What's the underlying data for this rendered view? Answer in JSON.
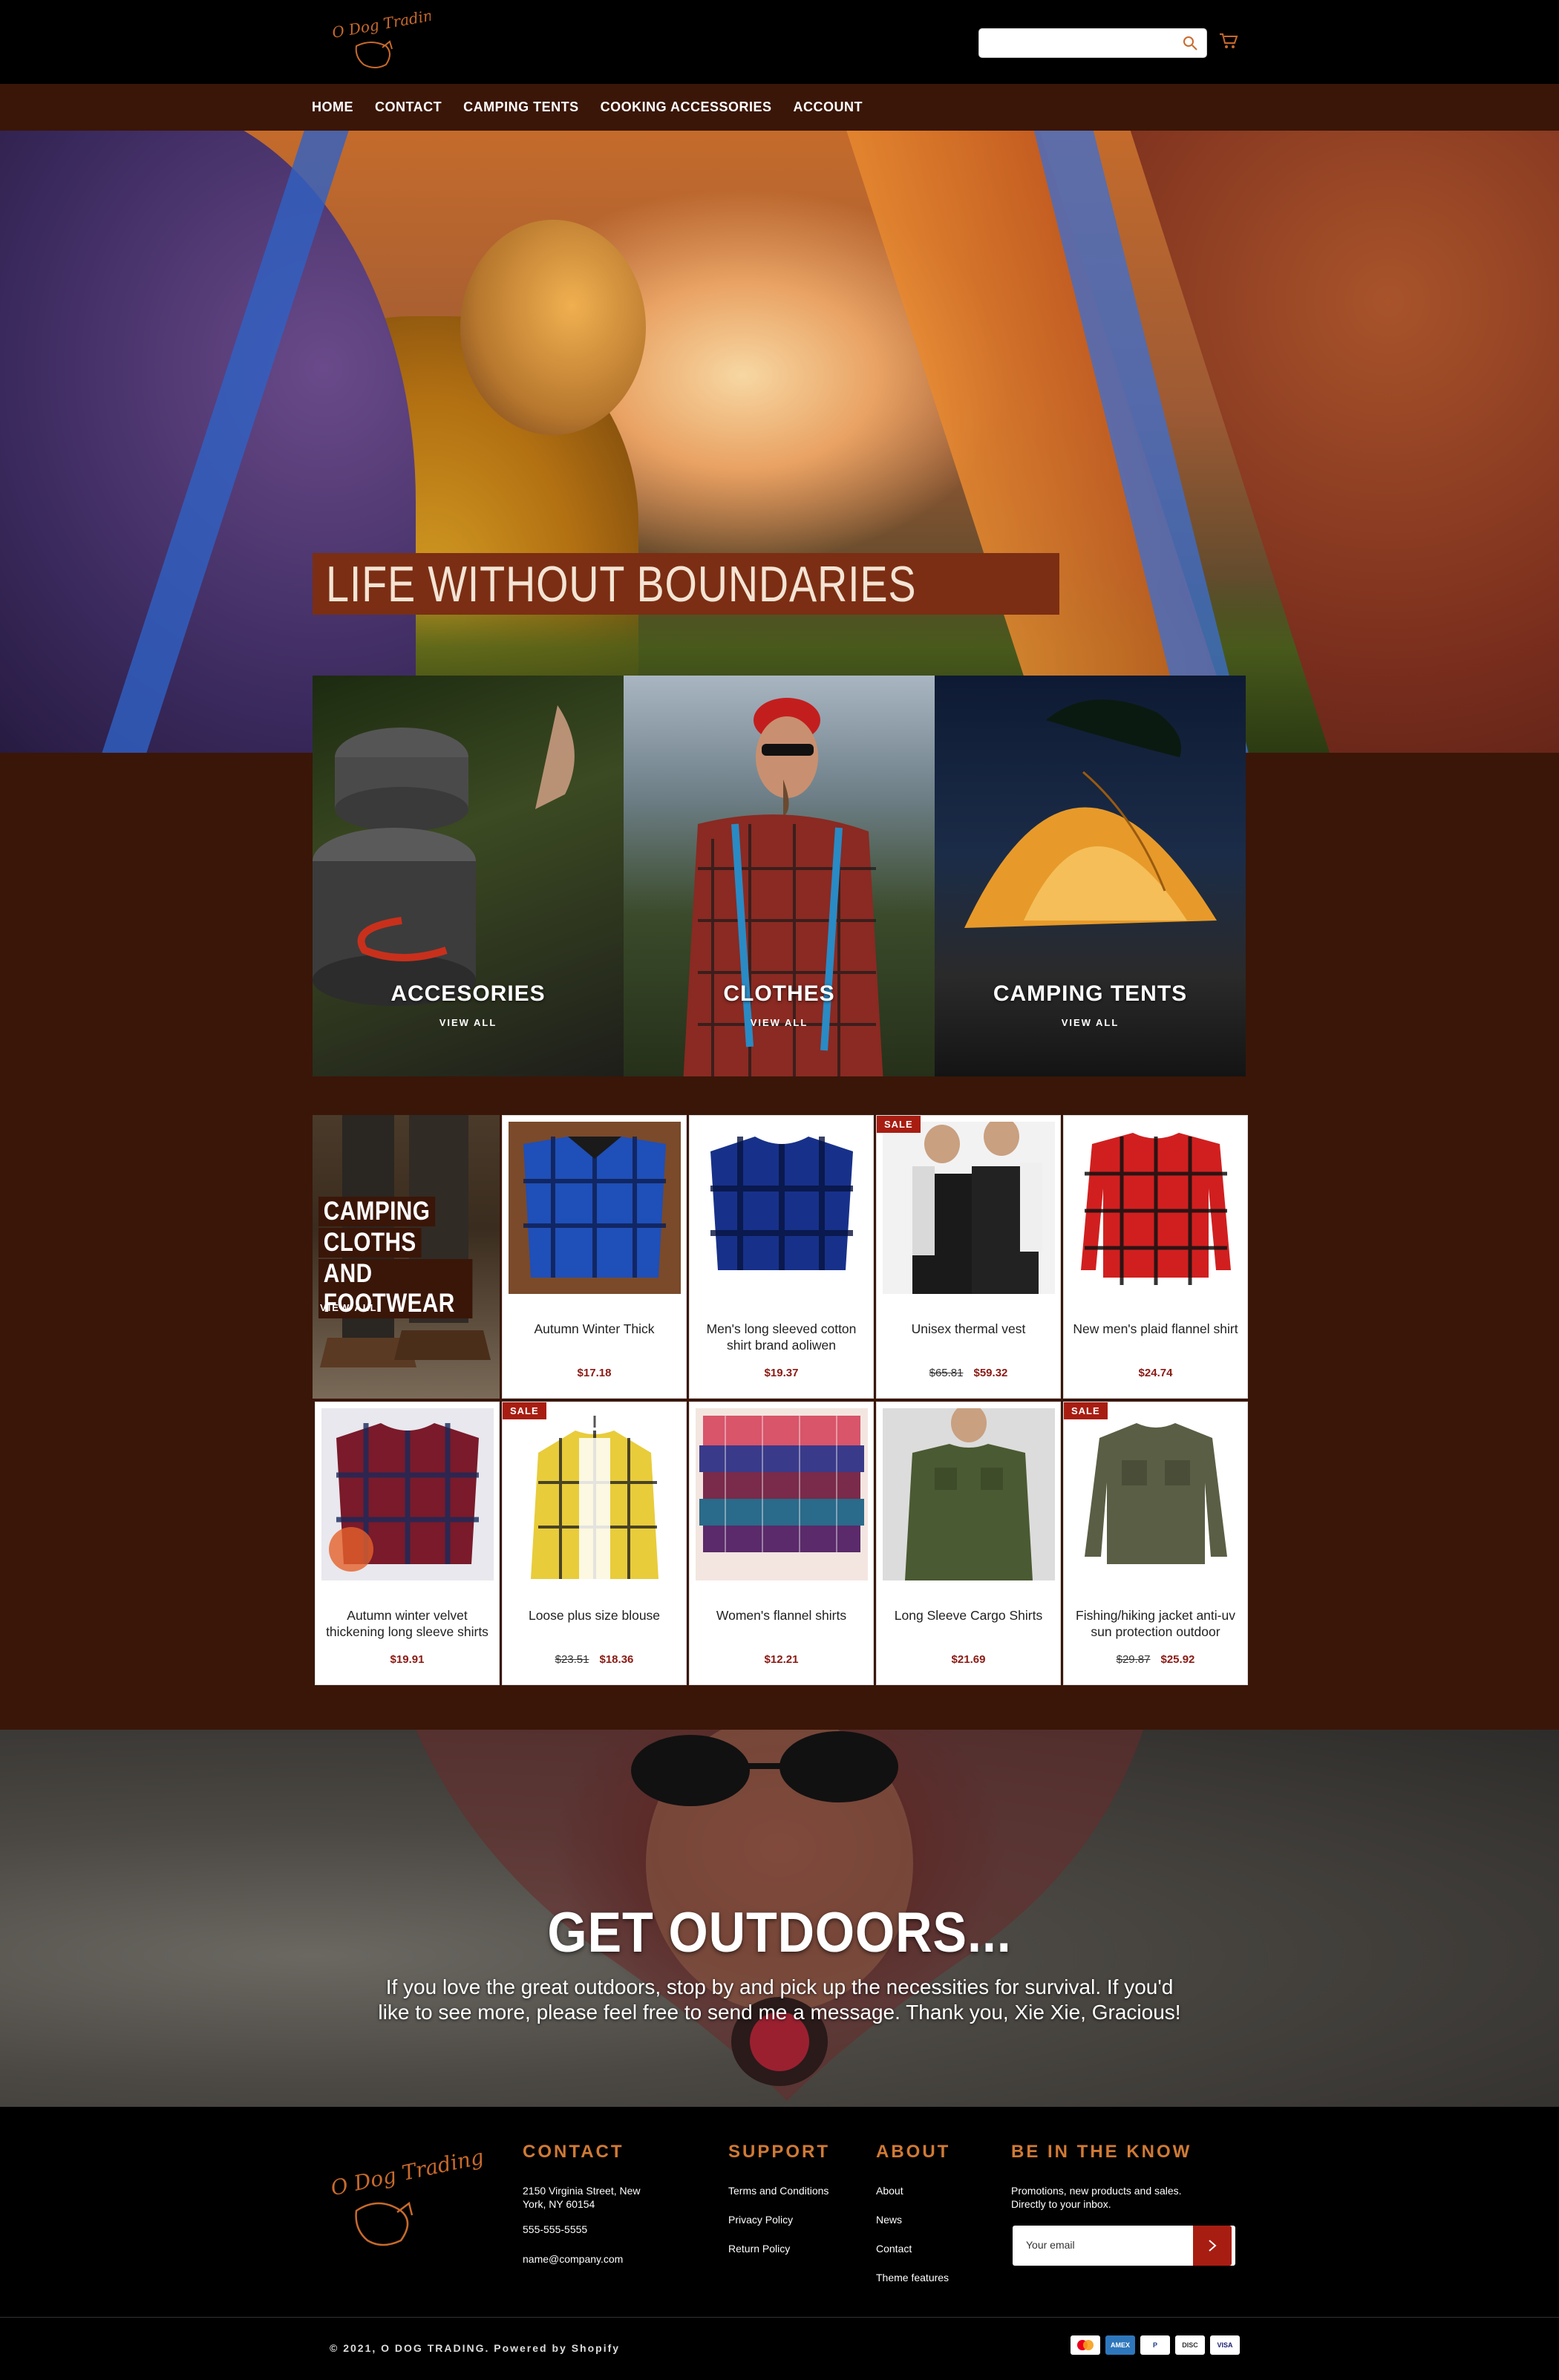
{
  "header": {
    "logo_text": "O Dog Trading",
    "search": {
      "placeholder": ""
    },
    "nav": [
      "HOME",
      "CONTACT",
      "CAMPING TENTS",
      "COOKING ACCESSORIES",
      "ACCOUNT"
    ]
  },
  "hero": {
    "title": "LIFE WITHOUT BOUNDARIES"
  },
  "categories": [
    {
      "label": "ACCESORIES",
      "link": "VIEW ALL"
    },
    {
      "label": "CLOTHES",
      "link": "VIEW ALL"
    },
    {
      "label": "CAMPING TENTS",
      "link": "VIEW ALL"
    }
  ],
  "promo": {
    "lines": [
      "CAMPING",
      "CLOTHS",
      "AND FOOTWEAR"
    ],
    "link": "VIEW ALL"
  },
  "products": [
    {
      "name": "Autumn Winter Thick",
      "price": "$17.18",
      "old": "",
      "sale": ""
    },
    {
      "name": "Men's long sleeved cotton shirt brand aoliwen",
      "price": "$19.37",
      "old": "",
      "sale": ""
    },
    {
      "name": "Unisex thermal vest",
      "price": "$59.32",
      "old": "$65.81",
      "sale": "SALE"
    },
    {
      "name": "New men's plaid flannel shirt",
      "price": "$24.74",
      "old": "",
      "sale": ""
    },
    {
      "name": "Autumn winter velvet thickening long sleeve shirts",
      "price": "$19.91",
      "old": "",
      "sale": ""
    },
    {
      "name": "Loose plus size blouse",
      "price": "$18.36",
      "old": "$23.51",
      "sale": "SALE"
    },
    {
      "name": "Women's flannel shirts",
      "price": "$12.21",
      "old": "",
      "sale": ""
    },
    {
      "name": "Long Sleeve Cargo Shirts",
      "price": "$21.69",
      "old": "",
      "sale": ""
    },
    {
      "name": "Fishing/hiking jacket anti-uv sun protection outdoor",
      "price": "$25.92",
      "old": "$29.87",
      "sale": "SALE"
    }
  ],
  "outdoors": {
    "title": "GET OUTDOORS...",
    "text": "If you love the great outdoors, stop by and pick up the necessities for survival. If you'd like to see more, please feel free to send me a message. Thank you, Xie Xie, Gracious!"
  },
  "footer": {
    "logo_text": "O Dog Trading",
    "contact": {
      "heading": "CONTACT",
      "address": "2150 Virginia Street, New York, NY 60154",
      "phone": "555-555-5555",
      "email": "name@company.com"
    },
    "support": {
      "heading": "SUPPORT",
      "links": [
        "Terms and Conditions",
        "Privacy Policy",
        "Return Policy"
      ]
    },
    "about": {
      "heading": "ABOUT",
      "links": [
        "About",
        "News",
        "Contact",
        "Theme features"
      ]
    },
    "newsletter": {
      "heading": "BE IN THE KNOW",
      "text": "Promotions, new products and sales. Directly to your inbox.",
      "placeholder": "Your email"
    },
    "copyright": "© 2021, O DOG TRADING. Powered by Shopify",
    "payments": [
      "Mastercard",
      "Amex",
      "PayPal",
      "Discover",
      "VISA"
    ]
  },
  "colors": {
    "brown": "#3a1608",
    "accent": "#d07a35",
    "sale": "#a81d12",
    "price": "#8b1a14"
  }
}
